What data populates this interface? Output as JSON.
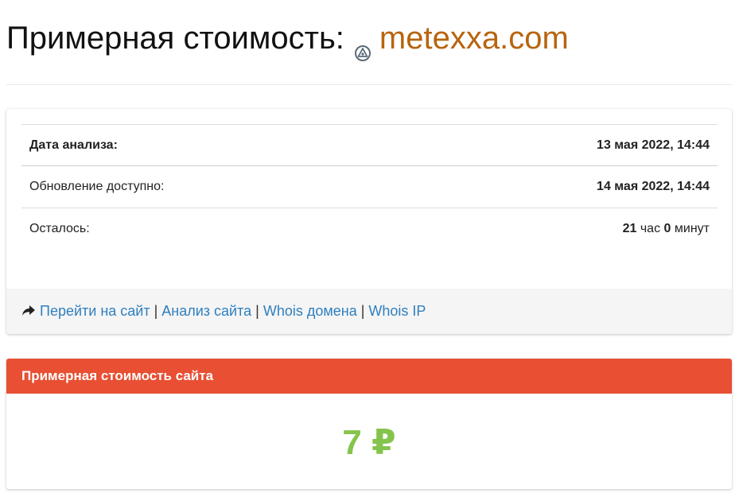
{
  "header": {
    "title_prefix": "Примерная стоимость:",
    "domain": "metexxa.com",
    "favicon_icon": "triangle-circle-logo-icon",
    "domain_color": "#b7650f"
  },
  "info": {
    "rows": [
      {
        "label": "Дата анализа:",
        "value": "13 мая 2022, 14:44"
      },
      {
        "label": "Обновление доступно:",
        "value": "14 мая 2022, 14:44"
      },
      {
        "label": "Осталось:",
        "hours": "21",
        "hours_unit": "час",
        "minutes": "0",
        "minutes_unit": "минут"
      }
    ]
  },
  "links": {
    "icon": "share-arrow-icon",
    "items": [
      {
        "label": "Перейти на сайт"
      },
      {
        "label": "Анализ сайта"
      },
      {
        "label": "Whois домена"
      },
      {
        "label": "Whois IP"
      }
    ],
    "separator": "|",
    "link_color": "#2f7fbf"
  },
  "estimate": {
    "heading": "Примерная стоимость сайта",
    "value": "7 ₽",
    "header_color": "#e84f33",
    "value_color": "#84c44c"
  }
}
